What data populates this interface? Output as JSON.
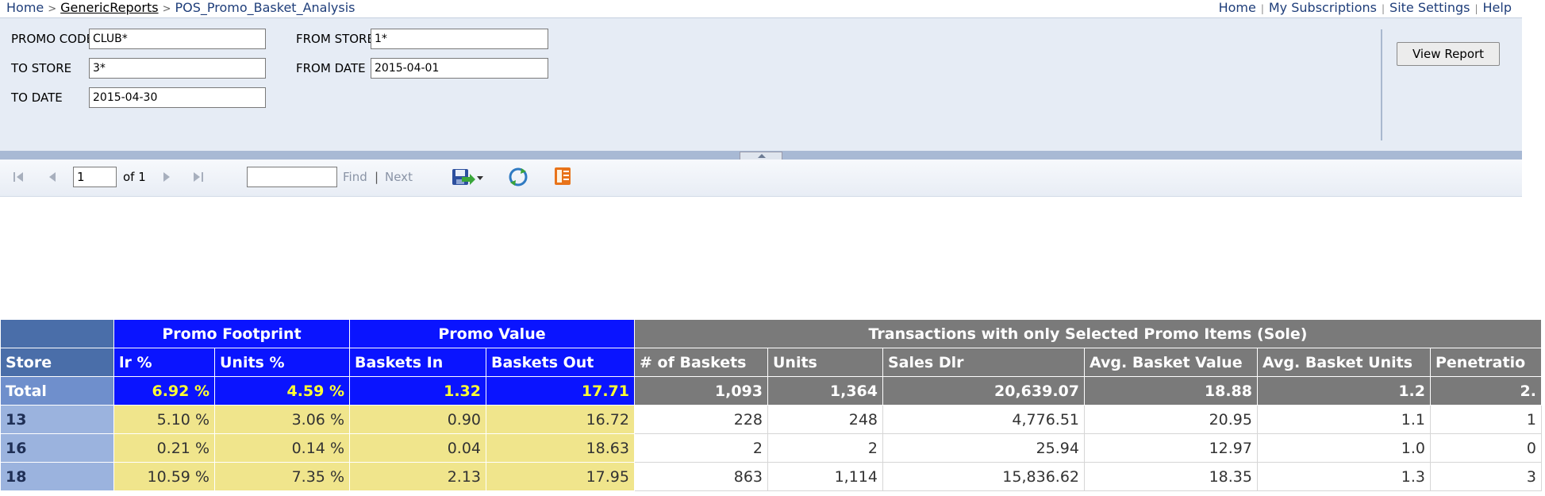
{
  "breadcrumb": {
    "home": "Home",
    "separator": ">",
    "folder": "GenericReports",
    "report": "POS_Promo_Basket_Analysis"
  },
  "top_links": {
    "home": "Home",
    "subscriptions": "My Subscriptions",
    "site_settings": "Site Settings",
    "help": "Help",
    "divider": "|"
  },
  "params": {
    "promo_code_label": "PROMO CODE",
    "promo_code_value": "CLUB*",
    "from_store_label": "FROM STORE",
    "from_store_value": "1*",
    "to_store_label": "TO STORE",
    "to_store_value": "3*",
    "from_date_label": "FROM DATE",
    "from_date_value": "2015-04-01",
    "to_date_label": "TO DATE",
    "to_date_value": "2015-04-30",
    "view_report": "View Report"
  },
  "toolbar": {
    "page_value": "1",
    "of_pages": "of 1",
    "find": "Find",
    "divider": "|",
    "next": "Next",
    "first_icon": "first-page-icon",
    "prev_icon": "previous-page-icon",
    "next_icon": "next-page-icon",
    "last_icon": "last-page-icon",
    "export_icon": "export-save-icon",
    "refresh_icon": "refresh-icon",
    "print_icon": "print-layout-icon"
  },
  "report": {
    "groups": {
      "promo_footprint": "Promo Footprint",
      "promo_value": "Promo Value",
      "sole": "Transactions with only Selected Promo Items (Sole)"
    },
    "columns": [
      "Store",
      "lr %",
      "Units %",
      "Baskets In",
      "Baskets Out",
      "# of Baskets",
      "Units",
      "Sales Dlr",
      "Avg. Basket Value",
      "Avg. Basket Units",
      "Penetratio"
    ],
    "total": [
      "Total",
      "6.92 %",
      "4.59 %",
      "1.32",
      "17.71",
      "1,093",
      "1,364",
      "20,639.07",
      "18.88",
      "1.2",
      "2."
    ],
    "rows": [
      [
        "13",
        "5.10 %",
        "3.06 %",
        "0.90",
        "16.72",
        "228",
        "248",
        "4,776.51",
        "20.95",
        "1.1",
        "1"
      ],
      [
        "16",
        "0.21 %",
        "0.14 %",
        "0.04",
        "18.63",
        "2",
        "2",
        "25.94",
        "12.97",
        "1.0",
        "0"
      ],
      [
        "18",
        "10.59 %",
        "7.35 %",
        "2.13",
        "17.95",
        "863",
        "1,114",
        "15,836.62",
        "18.35",
        "1.3",
        "3"
      ]
    ]
  },
  "colors": {
    "promo_header": "#0a14ff",
    "sole_header": "#7a7a7a",
    "store_header": "#4a6ea9",
    "total_highlight": "#ffff33",
    "promo_cell": "#f0e58c"
  }
}
